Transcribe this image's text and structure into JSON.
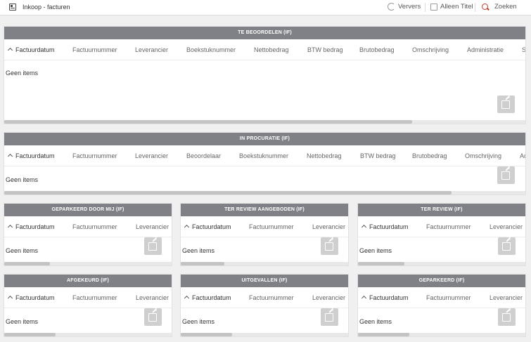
{
  "app": {
    "title": "Inkoop - facturen",
    "refresh_label": "Ververs",
    "title_only_label": "Alleen Titel",
    "search_label": "Zoeken"
  },
  "empty_text": "Geen items",
  "panels": {
    "te_beoordelen": {
      "title": "TE BEOORDELEN (IF)",
      "columns": [
        "Factuurdatum",
        "Factuurnummer",
        "Leverancier",
        "Boekstuknummer",
        "Nettobedrag",
        "BTW bedrag",
        "Brutobedrag",
        "Omschrijving",
        "Administratie",
        "St"
      ]
    },
    "in_procuratie": {
      "title": "IN PROCURATIE (IF)",
      "columns": [
        "Factuurdatum",
        "Factuurnummer",
        "Leverancier",
        "Beoordelaar",
        "Boekstuknummer",
        "Nettobedrag",
        "BTW bedrag",
        "Brutobedrag",
        "Omschrijving",
        "Ad"
      ]
    },
    "geparkeerd_door_mij": {
      "title": "GEPARKEERD DOOR MIJ (IF)",
      "columns": [
        "Factuurdatum",
        "Factuurnummer",
        "Leverancier"
      ]
    },
    "ter_review_aangeboden": {
      "title": "TER REVIEW AANGEBODEN (IF)",
      "columns": [
        "Factuurdatum",
        "Factuurnummer",
        "Leverancier"
      ]
    },
    "ter_review": {
      "title": "TER REVIEW (IF)",
      "columns": [
        "Factuurdatum",
        "Factuurnummer",
        "Leverancier"
      ]
    },
    "afgekeurd": {
      "title": "AFGEKEURD (IF)",
      "columns": [
        "Factuurdatum",
        "Factuurnummer",
        "Leverancier"
      ]
    },
    "uitgevallen": {
      "title": "UITGEVALLEN (IF)",
      "columns": [
        "Factuurdatum",
        "Factuurnummer",
        "Leverancier"
      ]
    },
    "geparkeerd": {
      "title": "GEPARKEERD (IF)",
      "columns": [
        "Factuurdatum",
        "Factuurnummer",
        "Leverancier"
      ]
    }
  }
}
